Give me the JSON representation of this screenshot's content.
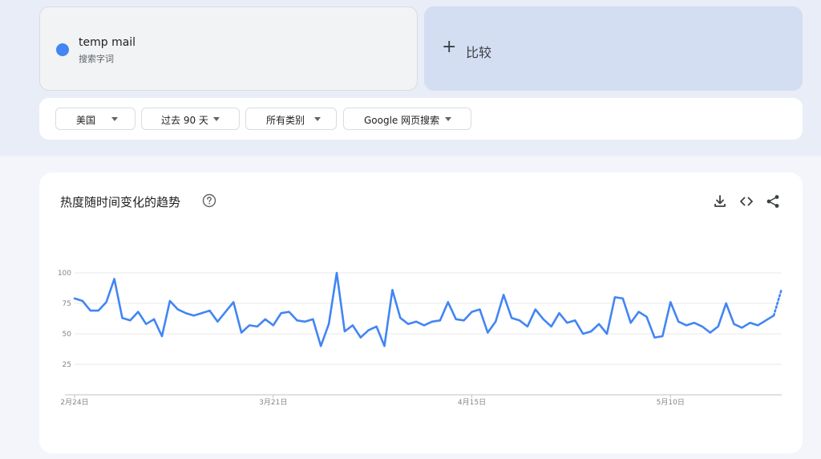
{
  "term": {
    "name": "temp mail",
    "subtitle": "搜索字词",
    "color": "#4285f4"
  },
  "compare": {
    "plus": "+",
    "label": "比较"
  },
  "filters": [
    {
      "label": "美国"
    },
    {
      "label": "过去 90 天"
    },
    {
      "label": "所有类别"
    },
    {
      "label": "Google 网页搜索"
    }
  ],
  "trend": {
    "title": "热度随时间变化的趋势"
  },
  "icons": [
    "help-icon",
    "download-icon",
    "embed-icon",
    "share-icon"
  ],
  "chart_data": {
    "type": "line",
    "title": "热度随时间变化的趋势",
    "ylim": [
      0,
      100
    ],
    "y_ticks": [
      {
        "value": 25,
        "label": "25"
      },
      {
        "value": 50,
        "label": "50"
      },
      {
        "value": 75,
        "label": "75"
      },
      {
        "value": 100,
        "label": "100"
      }
    ],
    "x_ticks": [
      {
        "index": 0,
        "label": "2月24日"
      },
      {
        "index": 25,
        "label": "3月21日"
      },
      {
        "index": 50,
        "label": "4月15日"
      },
      {
        "index": 75,
        "label": "5月10日"
      }
    ],
    "grid": true,
    "series": [
      {
        "name": "temp mail",
        "color": "#4285f4",
        "values": [
          79,
          77,
          69,
          69,
          76,
          95,
          63,
          61,
          68,
          58,
          62,
          48,
          77,
          70,
          67,
          65,
          67,
          69,
          60,
          68,
          76,
          51,
          57,
          56,
          62,
          57,
          67,
          68,
          61,
          60,
          62,
          40,
          58,
          100,
          52,
          57,
          47,
          53,
          56,
          40,
          86,
          63,
          58,
          60,
          57,
          60,
          61,
          76,
          62,
          61,
          68,
          70,
          51,
          60,
          82,
          63,
          61,
          56,
          70,
          62,
          56,
          67,
          59,
          61,
          50,
          52,
          58,
          50,
          80,
          79,
          59,
          68,
          64,
          47,
          48,
          76,
          60,
          57,
          59,
          56,
          51,
          56,
          75,
          58,
          55,
          59,
          57,
          61,
          65,
          87
        ],
        "partial_from_index": 88
      }
    ]
  }
}
